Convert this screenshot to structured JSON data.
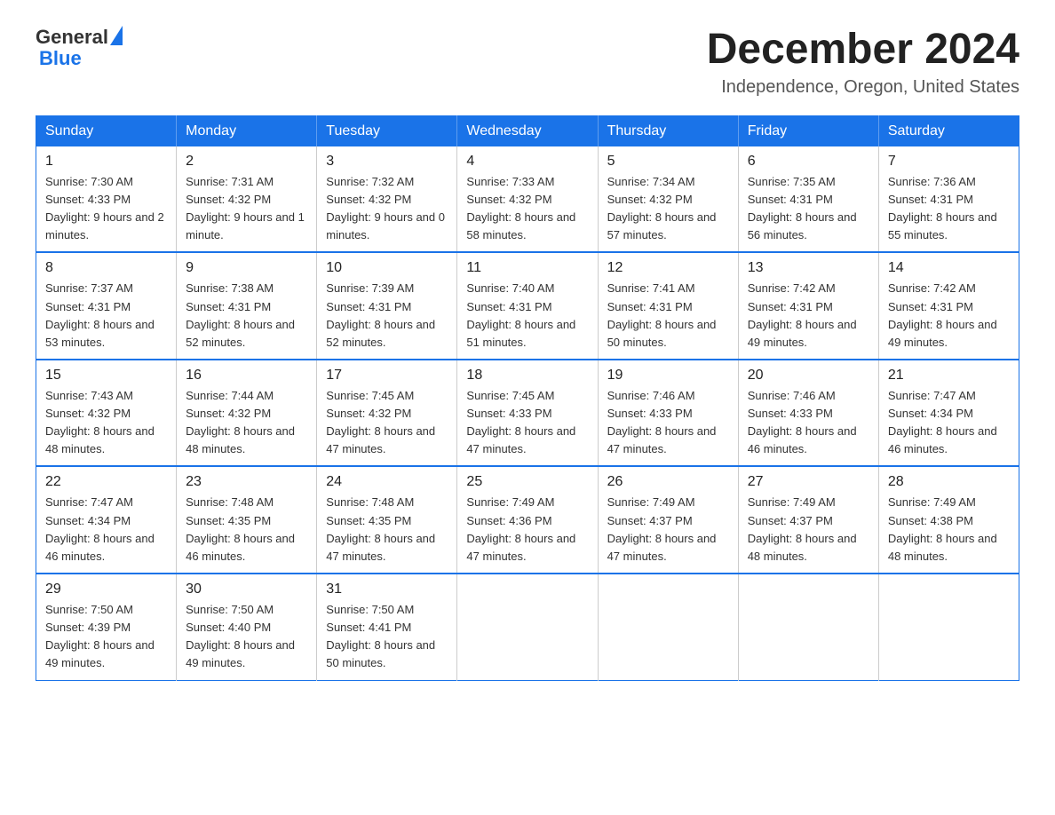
{
  "header": {
    "logo_general": "General",
    "logo_blue": "Blue",
    "month_title": "December 2024",
    "location": "Independence, Oregon, United States"
  },
  "days_of_week": [
    "Sunday",
    "Monday",
    "Tuesday",
    "Wednesday",
    "Thursday",
    "Friday",
    "Saturday"
  ],
  "weeks": [
    [
      {
        "day": "1",
        "sunrise": "7:30 AM",
        "sunset": "4:33 PM",
        "daylight": "9 hours and 2 minutes."
      },
      {
        "day": "2",
        "sunrise": "7:31 AM",
        "sunset": "4:32 PM",
        "daylight": "9 hours and 1 minute."
      },
      {
        "day": "3",
        "sunrise": "7:32 AM",
        "sunset": "4:32 PM",
        "daylight": "9 hours and 0 minutes."
      },
      {
        "day": "4",
        "sunrise": "7:33 AM",
        "sunset": "4:32 PM",
        "daylight": "8 hours and 58 minutes."
      },
      {
        "day": "5",
        "sunrise": "7:34 AM",
        "sunset": "4:32 PM",
        "daylight": "8 hours and 57 minutes."
      },
      {
        "day": "6",
        "sunrise": "7:35 AM",
        "sunset": "4:31 PM",
        "daylight": "8 hours and 56 minutes."
      },
      {
        "day": "7",
        "sunrise": "7:36 AM",
        "sunset": "4:31 PM",
        "daylight": "8 hours and 55 minutes."
      }
    ],
    [
      {
        "day": "8",
        "sunrise": "7:37 AM",
        "sunset": "4:31 PM",
        "daylight": "8 hours and 53 minutes."
      },
      {
        "day": "9",
        "sunrise": "7:38 AM",
        "sunset": "4:31 PM",
        "daylight": "8 hours and 52 minutes."
      },
      {
        "day": "10",
        "sunrise": "7:39 AM",
        "sunset": "4:31 PM",
        "daylight": "8 hours and 52 minutes."
      },
      {
        "day": "11",
        "sunrise": "7:40 AM",
        "sunset": "4:31 PM",
        "daylight": "8 hours and 51 minutes."
      },
      {
        "day": "12",
        "sunrise": "7:41 AM",
        "sunset": "4:31 PM",
        "daylight": "8 hours and 50 minutes."
      },
      {
        "day": "13",
        "sunrise": "7:42 AM",
        "sunset": "4:31 PM",
        "daylight": "8 hours and 49 minutes."
      },
      {
        "day": "14",
        "sunrise": "7:42 AM",
        "sunset": "4:31 PM",
        "daylight": "8 hours and 49 minutes."
      }
    ],
    [
      {
        "day": "15",
        "sunrise": "7:43 AM",
        "sunset": "4:32 PM",
        "daylight": "8 hours and 48 minutes."
      },
      {
        "day": "16",
        "sunrise": "7:44 AM",
        "sunset": "4:32 PM",
        "daylight": "8 hours and 48 minutes."
      },
      {
        "day": "17",
        "sunrise": "7:45 AM",
        "sunset": "4:32 PM",
        "daylight": "8 hours and 47 minutes."
      },
      {
        "day": "18",
        "sunrise": "7:45 AM",
        "sunset": "4:33 PM",
        "daylight": "8 hours and 47 minutes."
      },
      {
        "day": "19",
        "sunrise": "7:46 AM",
        "sunset": "4:33 PM",
        "daylight": "8 hours and 47 minutes."
      },
      {
        "day": "20",
        "sunrise": "7:46 AM",
        "sunset": "4:33 PM",
        "daylight": "8 hours and 46 minutes."
      },
      {
        "day": "21",
        "sunrise": "7:47 AM",
        "sunset": "4:34 PM",
        "daylight": "8 hours and 46 minutes."
      }
    ],
    [
      {
        "day": "22",
        "sunrise": "7:47 AM",
        "sunset": "4:34 PM",
        "daylight": "8 hours and 46 minutes."
      },
      {
        "day": "23",
        "sunrise": "7:48 AM",
        "sunset": "4:35 PM",
        "daylight": "8 hours and 46 minutes."
      },
      {
        "day": "24",
        "sunrise": "7:48 AM",
        "sunset": "4:35 PM",
        "daylight": "8 hours and 47 minutes."
      },
      {
        "day": "25",
        "sunrise": "7:49 AM",
        "sunset": "4:36 PM",
        "daylight": "8 hours and 47 minutes."
      },
      {
        "day": "26",
        "sunrise": "7:49 AM",
        "sunset": "4:37 PM",
        "daylight": "8 hours and 47 minutes."
      },
      {
        "day": "27",
        "sunrise": "7:49 AM",
        "sunset": "4:37 PM",
        "daylight": "8 hours and 48 minutes."
      },
      {
        "day": "28",
        "sunrise": "7:49 AM",
        "sunset": "4:38 PM",
        "daylight": "8 hours and 48 minutes."
      }
    ],
    [
      {
        "day": "29",
        "sunrise": "7:50 AM",
        "sunset": "4:39 PM",
        "daylight": "8 hours and 49 minutes."
      },
      {
        "day": "30",
        "sunrise": "7:50 AM",
        "sunset": "4:40 PM",
        "daylight": "8 hours and 49 minutes."
      },
      {
        "day": "31",
        "sunrise": "7:50 AM",
        "sunset": "4:41 PM",
        "daylight": "8 hours and 50 minutes."
      },
      null,
      null,
      null,
      null
    ]
  ]
}
